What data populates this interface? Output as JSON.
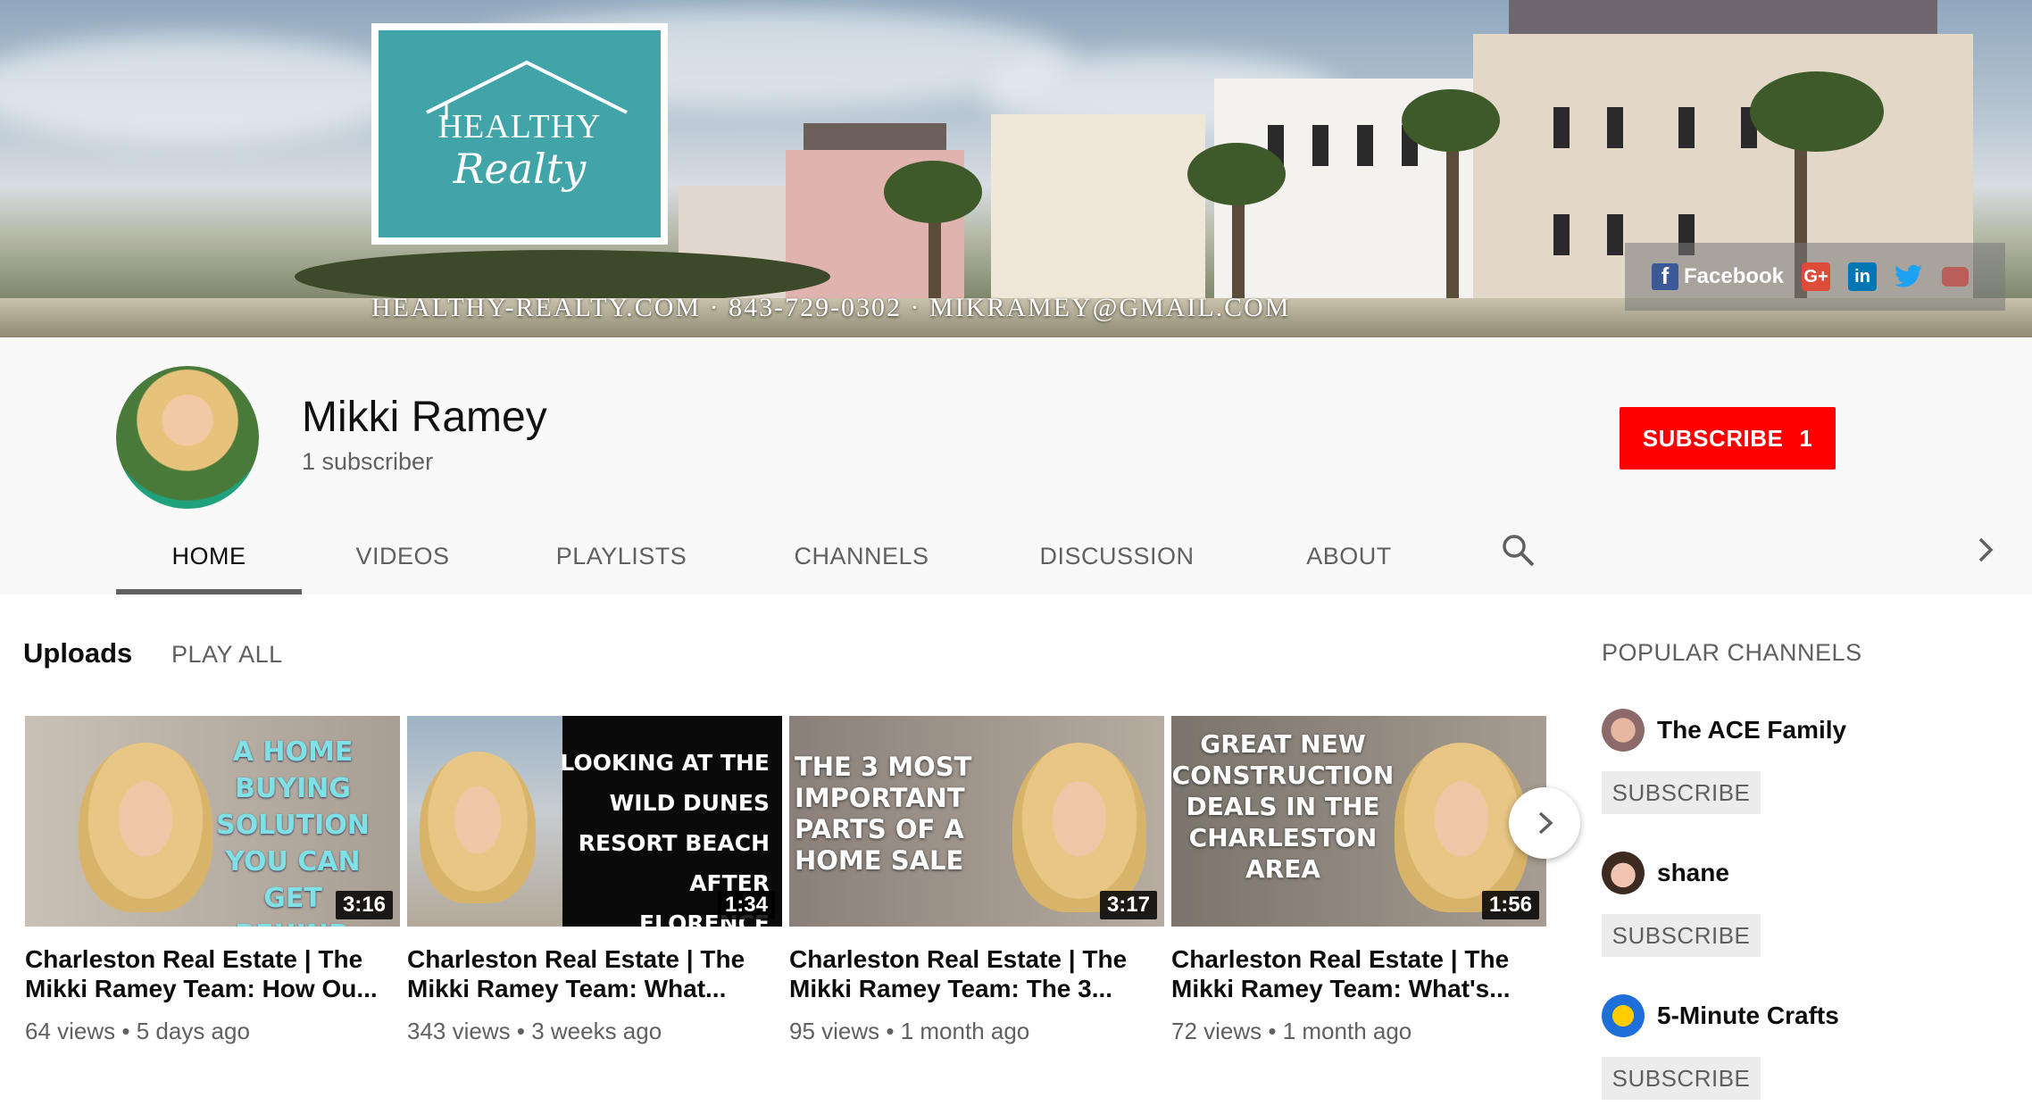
{
  "banner": {
    "logo_line1": "HEALTHY",
    "logo_line2": "Realty",
    "contact_line": "HEALTHY-REALTY.COM · 843-729-0302 · MIKRAMEY@GMAIL.COM",
    "social": {
      "facebook_label": "Facebook",
      "google_plus": "G+",
      "linkedin": "in",
      "twitter_icon": "twitter-icon"
    },
    "logo_color": "#40a4a8"
  },
  "channel": {
    "name": "Mikki Ramey",
    "subscribers": "1 subscriber",
    "subscribe_label": "SUBSCRIBE",
    "subscribe_count": "1",
    "accent": "#ff0000"
  },
  "tabs": [
    "HOME",
    "VIDEOS",
    "PLAYLISTS",
    "CHANNELS",
    "DISCUSSION",
    "ABOUT"
  ],
  "uploads": {
    "title": "Uploads",
    "play_all": "PLAY ALL",
    "videos": [
      {
        "thumb_text": "A HOME BUYING SOLUTION YOU CAN GET BEHIND",
        "duration": "3:16",
        "title": "Charleston Real Estate | The Mikki Ramey Team: How Ou...",
        "views": "64 views",
        "age": "5 days ago"
      },
      {
        "thumb_text": "LOOKING AT THE WILD DUNES RESORT BEACH AFTER FLORENCE",
        "duration": "1:34",
        "title": "Charleston Real Estate | The Mikki Ramey Team: What...",
        "views": "343 views",
        "age": "3 weeks ago"
      },
      {
        "thumb_text": "THE 3 MOST IMPORTANT PARTS OF A HOME SALE",
        "duration": "3:17",
        "title": "Charleston Real Estate | The Mikki Ramey Team: The 3...",
        "views": "95 views",
        "age": "1 month ago"
      },
      {
        "thumb_text": "GREAT NEW CONSTRUCTION DEALS IN THE CHARLESTON AREA",
        "duration": "1:56",
        "title": "Charleston Real Estate | The Mikki Ramey Team: What's...",
        "views": "72 views",
        "age": "1 month ago"
      }
    ]
  },
  "popular": {
    "title": "POPULAR CHANNELS",
    "channels": [
      {
        "name": "The ACE Family",
        "subscribe_label": "SUBSCRIBE"
      },
      {
        "name": "shane",
        "subscribe_label": "SUBSCRIBE"
      },
      {
        "name": "5-Minute Crafts",
        "subscribe_label": "SUBSCRIBE"
      }
    ]
  }
}
